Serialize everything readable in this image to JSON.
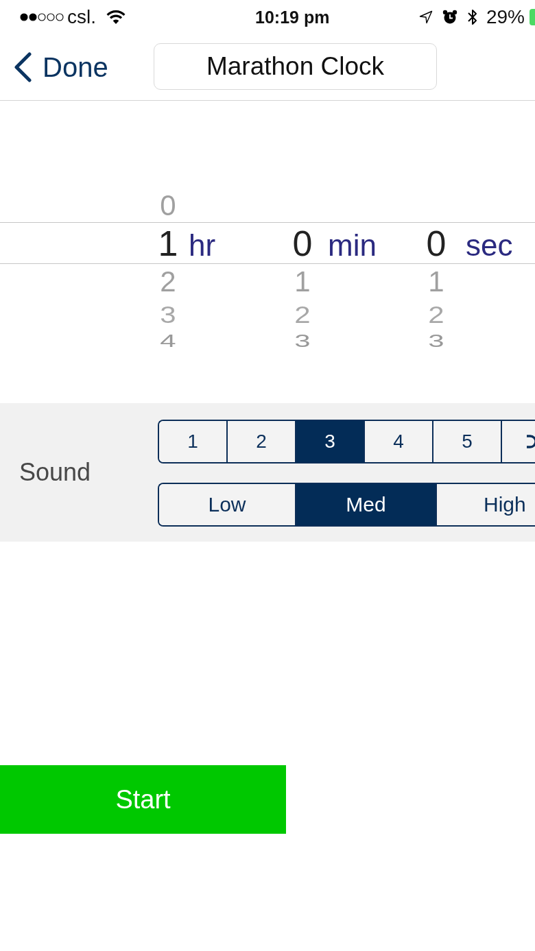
{
  "status_bar": {
    "carrier": "csl.",
    "time": "10:19 pm",
    "battery": "29%"
  },
  "nav_bar": {
    "back_button": "Done",
    "title": "Marathon Clock"
  },
  "picker": {
    "columns": [
      {
        "unit": "hr",
        "above": [
          "0"
        ],
        "value": "1",
        "below": [
          "2",
          "3",
          "4"
        ]
      },
      {
        "unit": "min",
        "value": "0",
        "below": [
          "1",
          "2",
          "3"
        ]
      },
      {
        "unit": "sec",
        "value": "0",
        "below": [
          "1",
          "2",
          "3"
        ]
      }
    ]
  },
  "sound": {
    "label": "Sound",
    "levels": [
      {
        "kind": "text",
        "label": "1",
        "selected": false
      },
      {
        "kind": "text",
        "label": "2",
        "selected": false
      },
      {
        "kind": "text",
        "label": "3",
        "selected": true
      },
      {
        "kind": "text",
        "label": "4",
        "selected": false
      },
      {
        "kind": "text",
        "label": "5",
        "selected": false
      },
      {
        "kind": "icon",
        "selected": false
      }
    ],
    "volume": [
      {
        "label": "Low",
        "selected": false
      },
      {
        "label": "Med",
        "selected": true
      },
      {
        "label": "High",
        "selected": false
      }
    ]
  },
  "start_button": {
    "label": "Start"
  }
}
